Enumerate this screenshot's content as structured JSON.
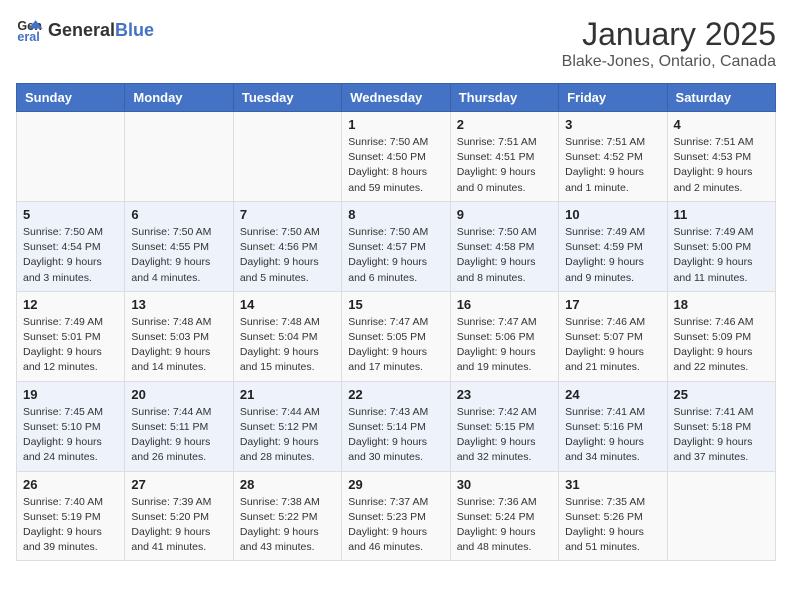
{
  "header": {
    "logo_general": "General",
    "logo_blue": "Blue",
    "month": "January 2025",
    "location": "Blake-Jones, Ontario, Canada"
  },
  "weekdays": [
    "Sunday",
    "Monday",
    "Tuesday",
    "Wednesday",
    "Thursday",
    "Friday",
    "Saturday"
  ],
  "weeks": [
    [
      {
        "day": "",
        "sunrise": "",
        "sunset": "",
        "daylight": ""
      },
      {
        "day": "",
        "sunrise": "",
        "sunset": "",
        "daylight": ""
      },
      {
        "day": "",
        "sunrise": "",
        "sunset": "",
        "daylight": ""
      },
      {
        "day": "1",
        "sunrise": "Sunrise: 7:50 AM",
        "sunset": "Sunset: 4:50 PM",
        "daylight": "Daylight: 8 hours and 59 minutes."
      },
      {
        "day": "2",
        "sunrise": "Sunrise: 7:51 AM",
        "sunset": "Sunset: 4:51 PM",
        "daylight": "Daylight: 9 hours and 0 minutes."
      },
      {
        "day": "3",
        "sunrise": "Sunrise: 7:51 AM",
        "sunset": "Sunset: 4:52 PM",
        "daylight": "Daylight: 9 hours and 1 minute."
      },
      {
        "day": "4",
        "sunrise": "Sunrise: 7:51 AM",
        "sunset": "Sunset: 4:53 PM",
        "daylight": "Daylight: 9 hours and 2 minutes."
      }
    ],
    [
      {
        "day": "5",
        "sunrise": "Sunrise: 7:50 AM",
        "sunset": "Sunset: 4:54 PM",
        "daylight": "Daylight: 9 hours and 3 minutes."
      },
      {
        "day": "6",
        "sunrise": "Sunrise: 7:50 AM",
        "sunset": "Sunset: 4:55 PM",
        "daylight": "Daylight: 9 hours and 4 minutes."
      },
      {
        "day": "7",
        "sunrise": "Sunrise: 7:50 AM",
        "sunset": "Sunset: 4:56 PM",
        "daylight": "Daylight: 9 hours and 5 minutes."
      },
      {
        "day": "8",
        "sunrise": "Sunrise: 7:50 AM",
        "sunset": "Sunset: 4:57 PM",
        "daylight": "Daylight: 9 hours and 6 minutes."
      },
      {
        "day": "9",
        "sunrise": "Sunrise: 7:50 AM",
        "sunset": "Sunset: 4:58 PM",
        "daylight": "Daylight: 9 hours and 8 minutes."
      },
      {
        "day": "10",
        "sunrise": "Sunrise: 7:49 AM",
        "sunset": "Sunset: 4:59 PM",
        "daylight": "Daylight: 9 hours and 9 minutes."
      },
      {
        "day": "11",
        "sunrise": "Sunrise: 7:49 AM",
        "sunset": "Sunset: 5:00 PM",
        "daylight": "Daylight: 9 hours and 11 minutes."
      }
    ],
    [
      {
        "day": "12",
        "sunrise": "Sunrise: 7:49 AM",
        "sunset": "Sunset: 5:01 PM",
        "daylight": "Daylight: 9 hours and 12 minutes."
      },
      {
        "day": "13",
        "sunrise": "Sunrise: 7:48 AM",
        "sunset": "Sunset: 5:03 PM",
        "daylight": "Daylight: 9 hours and 14 minutes."
      },
      {
        "day": "14",
        "sunrise": "Sunrise: 7:48 AM",
        "sunset": "Sunset: 5:04 PM",
        "daylight": "Daylight: 9 hours and 15 minutes."
      },
      {
        "day": "15",
        "sunrise": "Sunrise: 7:47 AM",
        "sunset": "Sunset: 5:05 PM",
        "daylight": "Daylight: 9 hours and 17 minutes."
      },
      {
        "day": "16",
        "sunrise": "Sunrise: 7:47 AM",
        "sunset": "Sunset: 5:06 PM",
        "daylight": "Daylight: 9 hours and 19 minutes."
      },
      {
        "day": "17",
        "sunrise": "Sunrise: 7:46 AM",
        "sunset": "Sunset: 5:07 PM",
        "daylight": "Daylight: 9 hours and 21 minutes."
      },
      {
        "day": "18",
        "sunrise": "Sunrise: 7:46 AM",
        "sunset": "Sunset: 5:09 PM",
        "daylight": "Daylight: 9 hours and 22 minutes."
      }
    ],
    [
      {
        "day": "19",
        "sunrise": "Sunrise: 7:45 AM",
        "sunset": "Sunset: 5:10 PM",
        "daylight": "Daylight: 9 hours and 24 minutes."
      },
      {
        "day": "20",
        "sunrise": "Sunrise: 7:44 AM",
        "sunset": "Sunset: 5:11 PM",
        "daylight": "Daylight: 9 hours and 26 minutes."
      },
      {
        "day": "21",
        "sunrise": "Sunrise: 7:44 AM",
        "sunset": "Sunset: 5:12 PM",
        "daylight": "Daylight: 9 hours and 28 minutes."
      },
      {
        "day": "22",
        "sunrise": "Sunrise: 7:43 AM",
        "sunset": "Sunset: 5:14 PM",
        "daylight": "Daylight: 9 hours and 30 minutes."
      },
      {
        "day": "23",
        "sunrise": "Sunrise: 7:42 AM",
        "sunset": "Sunset: 5:15 PM",
        "daylight": "Daylight: 9 hours and 32 minutes."
      },
      {
        "day": "24",
        "sunrise": "Sunrise: 7:41 AM",
        "sunset": "Sunset: 5:16 PM",
        "daylight": "Daylight: 9 hours and 34 minutes."
      },
      {
        "day": "25",
        "sunrise": "Sunrise: 7:41 AM",
        "sunset": "Sunset: 5:18 PM",
        "daylight": "Daylight: 9 hours and 37 minutes."
      }
    ],
    [
      {
        "day": "26",
        "sunrise": "Sunrise: 7:40 AM",
        "sunset": "Sunset: 5:19 PM",
        "daylight": "Daylight: 9 hours and 39 minutes."
      },
      {
        "day": "27",
        "sunrise": "Sunrise: 7:39 AM",
        "sunset": "Sunset: 5:20 PM",
        "daylight": "Daylight: 9 hours and 41 minutes."
      },
      {
        "day": "28",
        "sunrise": "Sunrise: 7:38 AM",
        "sunset": "Sunset: 5:22 PM",
        "daylight": "Daylight: 9 hours and 43 minutes."
      },
      {
        "day": "29",
        "sunrise": "Sunrise: 7:37 AM",
        "sunset": "Sunset: 5:23 PM",
        "daylight": "Daylight: 9 hours and 46 minutes."
      },
      {
        "day": "30",
        "sunrise": "Sunrise: 7:36 AM",
        "sunset": "Sunset: 5:24 PM",
        "daylight": "Daylight: 9 hours and 48 minutes."
      },
      {
        "day": "31",
        "sunrise": "Sunrise: 7:35 AM",
        "sunset": "Sunset: 5:26 PM",
        "daylight": "Daylight: 9 hours and 51 minutes."
      },
      {
        "day": "",
        "sunrise": "",
        "sunset": "",
        "daylight": ""
      }
    ]
  ]
}
